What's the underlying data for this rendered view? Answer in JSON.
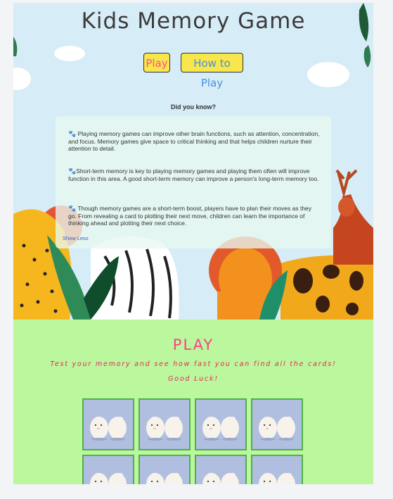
{
  "header": {
    "title": "Kids Memory Game",
    "play_button": "Play",
    "how_button": "How to Play"
  },
  "facts_section": {
    "heading": "Did you know?",
    "paw_icon": "🐾",
    "facts": [
      "Playing memory games can improve other brain functions, such as attention, concentration, and focus. Memory games give space to critical thinking and that helps children nurture their attention to detail.",
      "Short-term memory is key to playing memory games and playing them often will improve function in this area. A good short-term memory can improve a person's long-term memory too.",
      "Though memory games are a short-term boost, players have to plan their moves as they go. From revealing a card to plotting their next move, children can learn the importance of thinking ahead and plotting their next choice."
    ],
    "toggle_link": "Show Less"
  },
  "play_section": {
    "heading": "PLAY",
    "subtitle": "Test your memory and see how fast you can find all the cards!",
    "good_luck": "Good Luck!",
    "card_back_icon": "hamster-pair-icon",
    "visible_cards": 8
  },
  "colors": {
    "sky": "#d6ecf7",
    "play_bg": "#bbf79c",
    "button_yellow": "#f7e64c",
    "pink_text": "#ff3f88",
    "card_back": "#b0bee0",
    "card_border": "#4fb04a"
  }
}
